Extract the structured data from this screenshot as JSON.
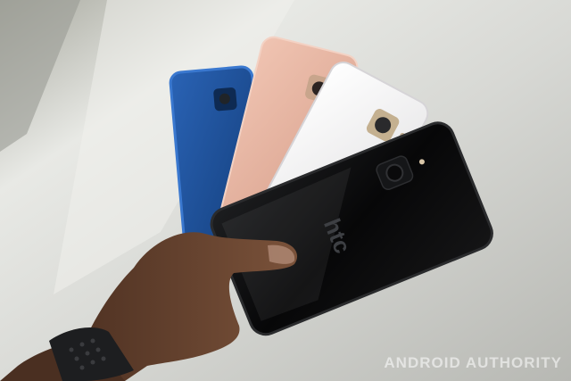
{
  "photo": {
    "subject": "hand-holding-four-phones",
    "colors": {
      "background_light": "#e6e7e3",
      "background_dark": "#a9aba6",
      "phone_blue": "#1c4f9a",
      "phone_pink": "#e6b29f",
      "phone_white": "#f1eff0",
      "phone_black": "#0b0b0c",
      "skin": "#6e4a34"
    }
  },
  "brand_mark": "htc",
  "watermark": "ANDROID AUTHORITY"
}
